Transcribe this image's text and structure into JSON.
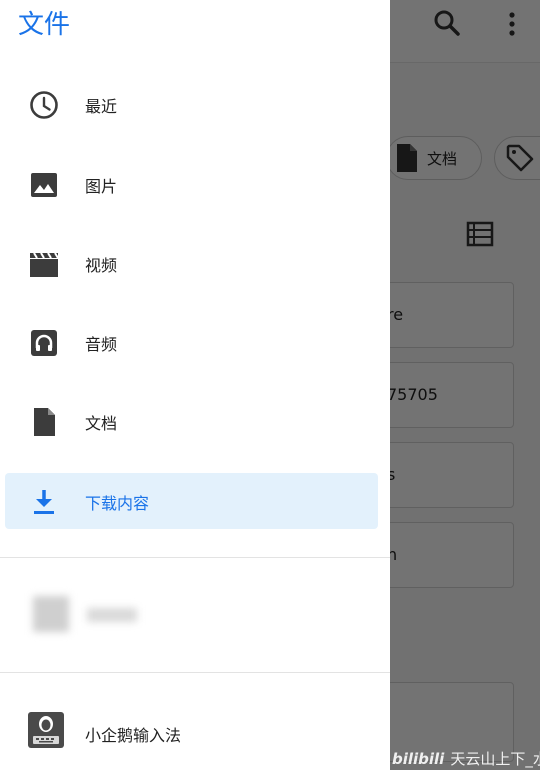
{
  "drawer": {
    "title": "文件",
    "items": [
      {
        "label": "最近",
        "icon": "clock-icon"
      },
      {
        "label": "图片",
        "icon": "image-icon"
      },
      {
        "label": "视频",
        "icon": "movie-icon"
      },
      {
        "label": "音频",
        "icon": "headphones-icon"
      },
      {
        "label": "文档",
        "icon": "document-icon"
      },
      {
        "label": "下载内容",
        "icon": "download-icon",
        "selected": true
      }
    ],
    "app": {
      "label": "小企鹅输入法",
      "icon": "keyboard-app-icon"
    }
  },
  "background": {
    "chips": [
      {
        "label": "文档",
        "icon": "document-icon"
      },
      {
        "label": "",
        "icon": "tag-icon"
      }
    ],
    "cards": [
      {
        "text": "re"
      },
      {
        "text": "75705"
      },
      {
        "text": "s"
      },
      {
        "text": "n"
      }
    ]
  },
  "watermark": {
    "logo": "bilibili",
    "text": "天云山上下_水墨"
  },
  "colors": {
    "accent": "#1a73e8",
    "selected_bg": "#e3f1fc",
    "icon": "#3c3c3c"
  }
}
